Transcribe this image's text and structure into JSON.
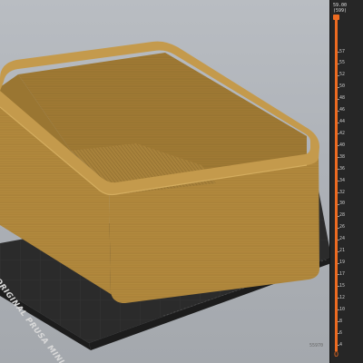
{
  "bed": {
    "brand_label": "ORIGINAL PRUSA MINI",
    "bottom_coord": "55970"
  },
  "layer_slider": {
    "top_height": "59.00",
    "top_layer": "(599)",
    "accent_color": "#ed6b21",
    "bottom_label": "0",
    "ticks": [
      "57",
      "55",
      "52",
      "50",
      "48",
      "46",
      "44",
      "42",
      "40",
      "38",
      "36",
      "34",
      "32",
      "30",
      "28",
      "26",
      "24",
      "21",
      "19",
      "17",
      "15",
      "12",
      "10",
      "8",
      "6",
      "4"
    ]
  },
  "model": {
    "color": "#b48b3f"
  }
}
